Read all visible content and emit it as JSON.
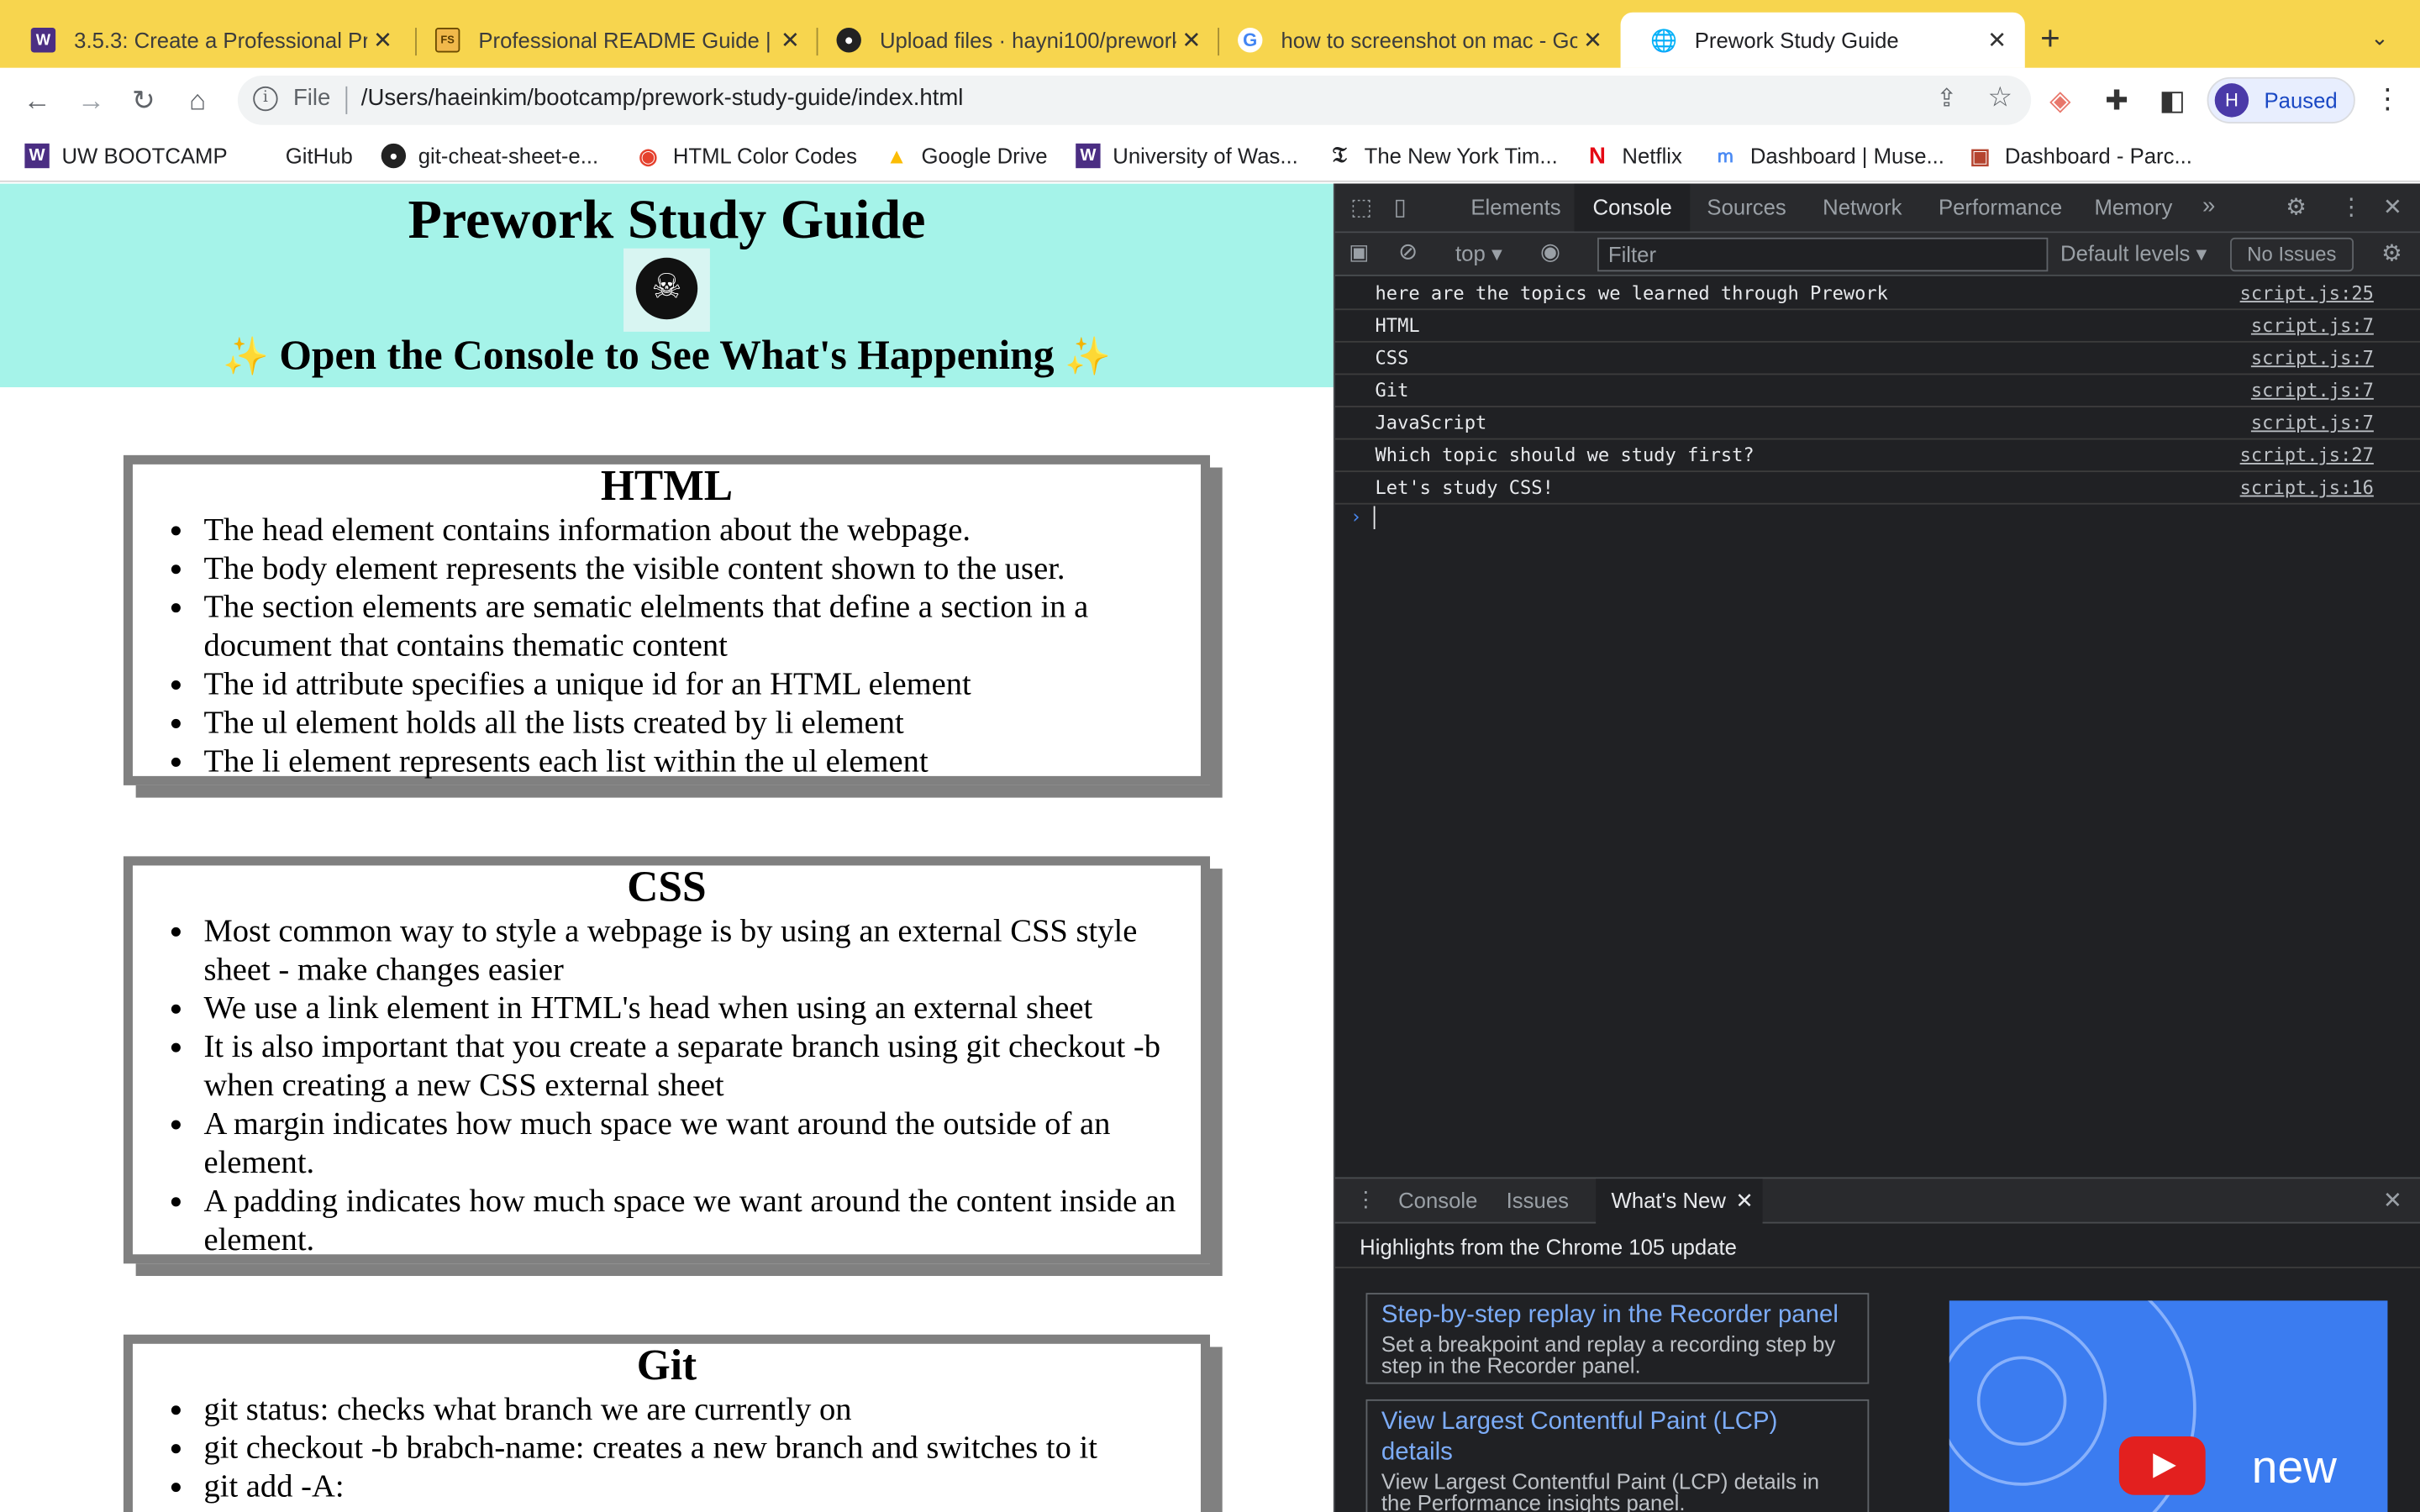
{
  "browser": {
    "tabs": [
      {
        "title": "3.5.3: Create a Professional Pr",
        "icon": "canvas-w-icon"
      },
      {
        "title": "Professional README Guide | T",
        "icon": "fs-icon"
      },
      {
        "title": "Upload files · hayni100/prework",
        "icon": "github-icon"
      },
      {
        "title": "how to screenshot on mac - Go",
        "icon": "google-icon"
      },
      {
        "title": "Prework Study Guide",
        "icon": "globe-icon"
      }
    ],
    "omnibox": {
      "scheme": "File",
      "url": "/Users/haeinkim/bootcamp/prework-study-guide/index.html"
    },
    "profile": {
      "initial": "H",
      "status": "Paused"
    },
    "bookmarks": [
      "UW BOOTCAMP",
      "GitHub",
      "git-cheat-sheet-e...",
      "HTML Color Codes",
      "Google Drive",
      "University of Was...",
      "The New York Tim...",
      "Netflix",
      "Dashboard | Muse...",
      "Dashboard - Parc..."
    ]
  },
  "page": {
    "title": "Prework Study Guide",
    "subtitle": "Open the Console to See What's Happening",
    "sections": [
      {
        "heading": "HTML",
        "items": [
          "The head element contains information about the webpage.",
          "The body element represents the visible content shown to the user.",
          "The section elements are sematic elelments that define a section in a document that contains thematic content",
          "The id attribute specifies a unique id for an HTML element",
          "The ul element holds all the lists created by li element",
          "The li element represents each list within the ul element"
        ]
      },
      {
        "heading": "CSS",
        "items": [
          "Most common way to style a webpage is by using an external CSS style sheet - make changes easier",
          "We use a link element in HTML's head when using an external sheet",
          "It is also important that you create a separate branch using git checkout -b when creating a new CSS external sheet",
          "A margin indicates how much space we want around the outside of an element.",
          "A padding indicates how much space we want around the content inside an element."
        ]
      },
      {
        "heading": "Git",
        "items": [
          "git status: checks what branch we are currently on",
          "git checkout -b brabch-name: creates a new branch and switches to it",
          "git add -A:"
        ]
      }
    ]
  },
  "devtools": {
    "tabs": [
      "Elements",
      "Console",
      "Sources",
      "Network",
      "Performance",
      "Memory"
    ],
    "active_tab": "Console",
    "context": "top",
    "filter_placeholder": "Filter",
    "levels": "Default levels",
    "issues": "No Issues",
    "console_log": [
      {
        "message": "here are the topics we learned through Prework",
        "source": "script.js:25"
      },
      {
        "message": "HTML",
        "source": "script.js:7"
      },
      {
        "message": "CSS",
        "source": "script.js:7"
      },
      {
        "message": "Git",
        "source": "script.js:7"
      },
      {
        "message": "JavaScript",
        "source": "script.js:7"
      },
      {
        "message": "Which topic should we study first?",
        "source": "script.js:27"
      },
      {
        "message": "Let's study CSS!",
        "source": "script.js:16"
      }
    ],
    "drawer": {
      "tabs": [
        "Console",
        "Issues",
        "What's New"
      ],
      "heading": "Highlights from the Chrome 105 update",
      "cards": [
        {
          "title": "Step-by-step replay in the Recorder panel",
          "desc": "Set a breakpoint and replay a recording step by step in the Recorder panel."
        },
        {
          "title": "View Largest Contentful Paint (LCP) details",
          "desc": "View Largest Contentful Paint (LCP) details in the Performance insights panel."
        }
      ],
      "video_label": "new"
    }
  },
  "colors": {
    "tabstrip": "#f7d54e",
    "hero": "#a5f3e9",
    "card_border": "#808080",
    "devtools_bg": "#202124"
  }
}
